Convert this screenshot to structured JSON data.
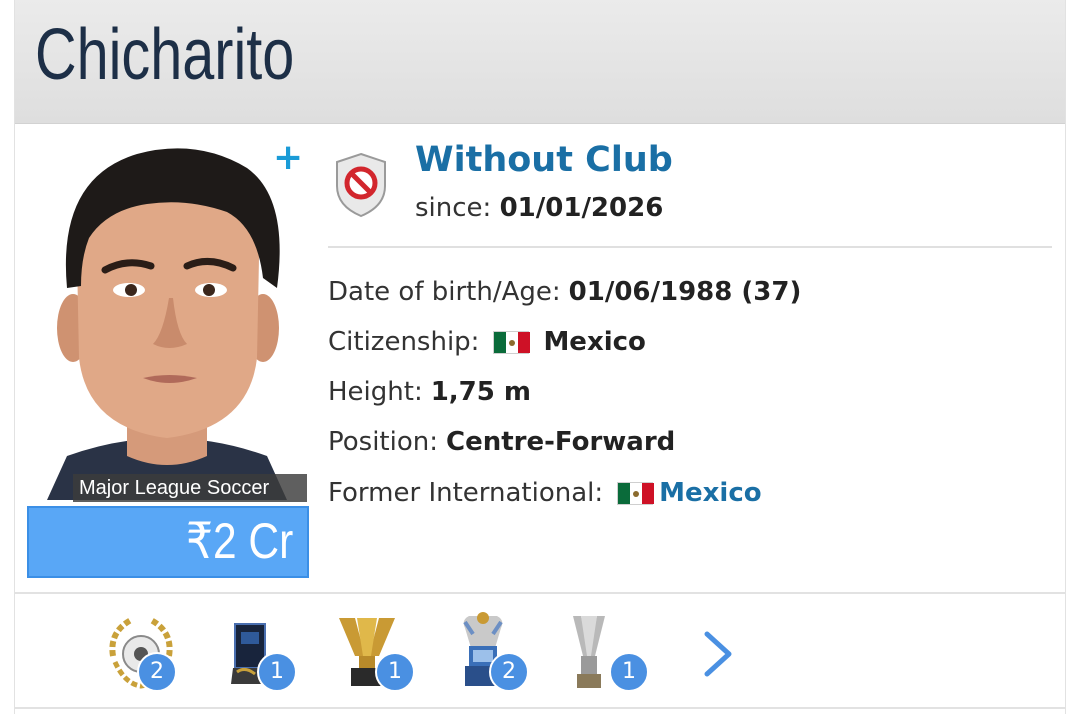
{
  "header": {
    "title": "Chicharito"
  },
  "profile": {
    "photo_label": "Major League Soccer",
    "market_value": "₹2 Cr",
    "add_icon": "plus-icon"
  },
  "club": {
    "name": "Without Club",
    "since_label": "since:",
    "since_value": "01/01/2026",
    "icon": "no-club-shield-icon"
  },
  "info": {
    "dob_label": "Date of birth/Age:",
    "dob_value": "01/06/1988 (37)",
    "citizenship_label": "Citizenship:",
    "citizenship_value": "Mexico",
    "height_label": "Height:",
    "height_value": "1,75 m",
    "position_label": "Position:",
    "position_value": "Centre-Forward",
    "former_intl_label": "Former International:",
    "former_intl_value": "Mexico"
  },
  "trophies": [
    {
      "icon": "laurel-ball-trophy-icon",
      "count": "2"
    },
    {
      "icon": "golden-boot-trophy-icon",
      "count": "1"
    },
    {
      "icon": "gold-cup-trophy-icon",
      "count": "1"
    },
    {
      "icon": "premier-league-trophy-icon",
      "count": "2"
    },
    {
      "icon": "silver-cup-trophy-icon",
      "count": "1"
    }
  ],
  "colors": {
    "accent": "#1a6fa5",
    "badge": "#4a90e2",
    "value_box": "#59a7f6"
  }
}
